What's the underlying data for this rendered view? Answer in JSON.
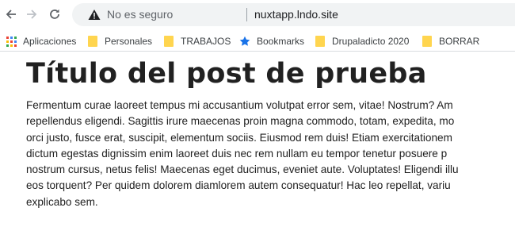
{
  "browser": {
    "not_secure_label": "No es seguro",
    "url": "nuxtapp.lndo.site",
    "bookmarks": [
      {
        "label": "Aplicaciones",
        "icon": "apps-grid-icon"
      },
      {
        "label": "Personales",
        "icon": "folder-icon"
      },
      {
        "label": "TRABAJOS",
        "icon": "folder-icon"
      },
      {
        "label": "Bookmarks",
        "icon": "star-icon"
      },
      {
        "label": "Drupaladicto 2020",
        "icon": "folder-icon"
      },
      {
        "label": "BORRAR",
        "icon": "folder-icon"
      }
    ],
    "colors": {
      "folder": "#ffd54f",
      "star": "#1a73e8",
      "omnibox": "#f1f3f4"
    }
  },
  "post": {
    "title": "Título del post de prueba",
    "body_lines": [
      "Fermentum curae laoreet tempus mi accusantium volutpat error sem, vitae! Nostrum? Am",
      "repellendus eligendi. Sagittis irure maecenas proin magna commodo, totam, expedita, mo",
      "orci justo, fusce erat, suscipit, elementum sociis. Eiusmod rem duis! Etiam exercitationem",
      "dictum egestas dignissim enim laoreet duis nec rem nullam eu tempor tenetur posuere p",
      "nostrum cursus, netus felis! Maecenas eget ducimus, eveniet aute. Voluptates! Eligendi illu",
      "eos torquent? Per quidem dolorem diamlorem autem consequatur! Hac leo repellat, variu",
      "explicabo sem."
    ]
  }
}
